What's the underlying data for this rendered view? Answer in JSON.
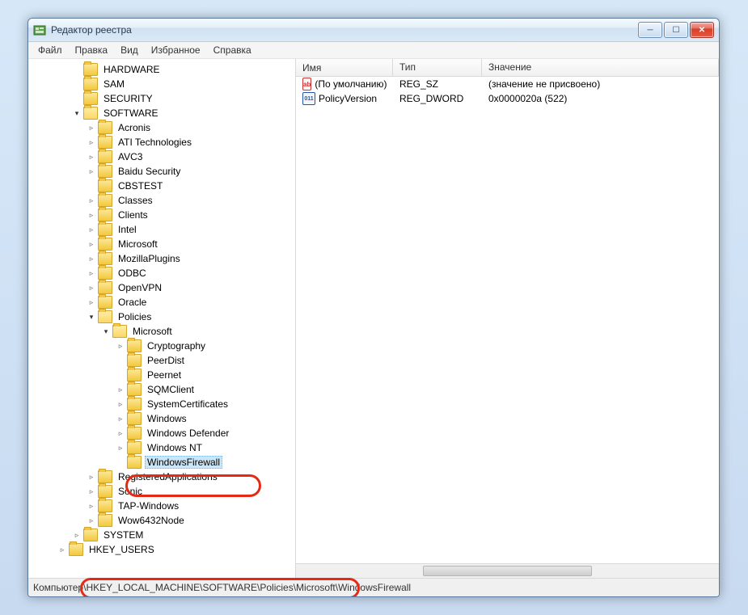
{
  "window": {
    "title": "Редактор реестра"
  },
  "menubar": [
    "Файл",
    "Правка",
    "Вид",
    "Избранное",
    "Справка"
  ],
  "tree": [
    {
      "indent": 3,
      "arrow": "",
      "label": "HARDWARE"
    },
    {
      "indent": 3,
      "arrow": "",
      "label": "SAM"
    },
    {
      "indent": 3,
      "arrow": "",
      "label": "SECURITY"
    },
    {
      "indent": 3,
      "arrow": "open",
      "label": "SOFTWARE"
    },
    {
      "indent": 4,
      "arrow": ">",
      "label": "Acronis"
    },
    {
      "indent": 4,
      "arrow": ">",
      "label": "ATI Technologies"
    },
    {
      "indent": 4,
      "arrow": ">",
      "label": "AVC3"
    },
    {
      "indent": 4,
      "arrow": ">",
      "label": "Baidu Security"
    },
    {
      "indent": 4,
      "arrow": "",
      "label": "CBSTEST"
    },
    {
      "indent": 4,
      "arrow": ">",
      "label": "Classes"
    },
    {
      "indent": 4,
      "arrow": ">",
      "label": "Clients"
    },
    {
      "indent": 4,
      "arrow": ">",
      "label": "Intel"
    },
    {
      "indent": 4,
      "arrow": ">",
      "label": "Microsoft"
    },
    {
      "indent": 4,
      "arrow": ">",
      "label": "MozillaPlugins"
    },
    {
      "indent": 4,
      "arrow": ">",
      "label": "ODBC"
    },
    {
      "indent": 4,
      "arrow": ">",
      "label": "OpenVPN"
    },
    {
      "indent": 4,
      "arrow": ">",
      "label": "Oracle"
    },
    {
      "indent": 4,
      "arrow": "open",
      "label": "Policies"
    },
    {
      "indent": 5,
      "arrow": "open",
      "label": "Microsoft"
    },
    {
      "indent": 6,
      "arrow": ">",
      "label": "Cryptography"
    },
    {
      "indent": 6,
      "arrow": "",
      "label": "PeerDist"
    },
    {
      "indent": 6,
      "arrow": "",
      "label": "Peernet"
    },
    {
      "indent": 6,
      "arrow": ">",
      "label": "SQMClient"
    },
    {
      "indent": 6,
      "arrow": ">",
      "label": "SystemCertificates"
    },
    {
      "indent": 6,
      "arrow": ">",
      "label": "Windows"
    },
    {
      "indent": 6,
      "arrow": ">",
      "label": "Windows Defender"
    },
    {
      "indent": 6,
      "arrow": ">",
      "label": "Windows NT"
    },
    {
      "indent": 6,
      "arrow": "",
      "label": "WindowsFirewall",
      "selected": true
    },
    {
      "indent": 4,
      "arrow": ">",
      "label": "RegisteredApplications"
    },
    {
      "indent": 4,
      "arrow": ">",
      "label": "Sonic"
    },
    {
      "indent": 4,
      "arrow": ">",
      "label": "TAP-Windows"
    },
    {
      "indent": 4,
      "arrow": ">",
      "label": "Wow6432Node"
    },
    {
      "indent": 3,
      "arrow": ">",
      "label": "SYSTEM"
    },
    {
      "indent": 2,
      "arrow": ">",
      "label": "HKEY_USERS"
    }
  ],
  "list": {
    "headers": {
      "name": "Имя",
      "type": "Тип",
      "value": "Значение"
    },
    "rows": [
      {
        "icon": "ab",
        "name": "(По умолчанию)",
        "type": "REG_SZ",
        "value": "(значение не присвоено)"
      },
      {
        "icon": "hex",
        "name": "PolicyVersion",
        "type": "REG_DWORD",
        "value": "0x0000020a (522)"
      }
    ]
  },
  "statusbar": {
    "prefix": "Компьютер",
    "path_highlight": "\\HKEY_LOCAL_MACHINE\\SOFTWARE\\Policies\\Microsoft\\",
    "path_tail": "WindowsFirewall"
  }
}
